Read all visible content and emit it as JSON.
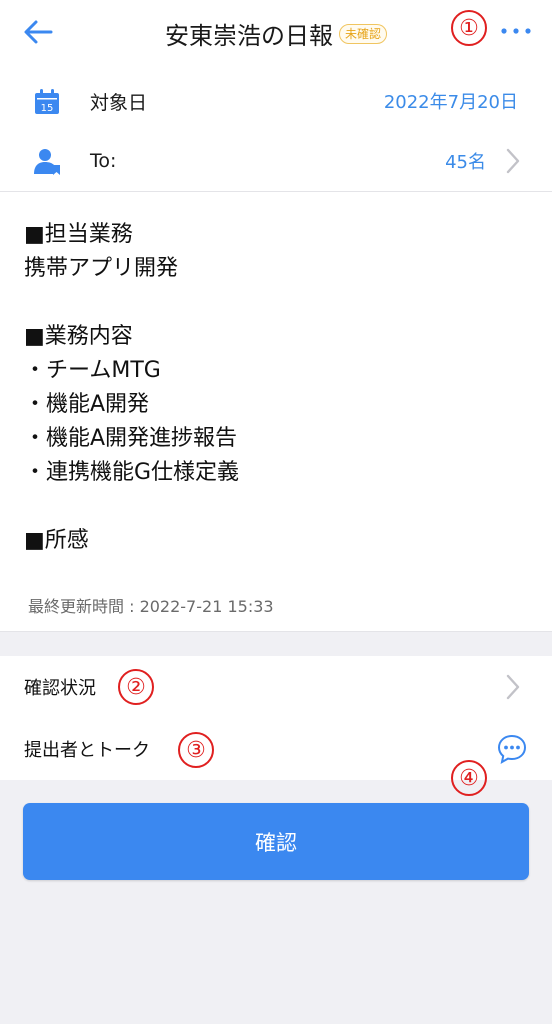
{
  "header": {
    "title": "安東崇浩の日報",
    "badge": "未確認",
    "back_icon": "arrow-left-icon",
    "more_icon": "more-dots-icon"
  },
  "info": {
    "date_label": "対象日",
    "date_value": "2022年7月20日",
    "date_icon_day": "15",
    "to_label": "To:",
    "to_value": "45名"
  },
  "report": {
    "body": "■担当業務\n携帯アプリ開発\n\n■業務内容\n・チームMTG\n・機能A開発\n・機能A開発進捗報告\n・連携機能G仕様定義\n\n■所感",
    "updated": "最終更新時間 : 2022-7-21 15:33"
  },
  "links": {
    "status_label": "確認状況",
    "talk_label": "提出者とトーク"
  },
  "confirm_button": "確認",
  "annotations": [
    "①",
    "②",
    "③",
    "④"
  ],
  "colors": {
    "accent": "#3b88f0",
    "link_blue": "#3b8be8",
    "badge": "#e7a41a",
    "annotation": "#e02020"
  }
}
